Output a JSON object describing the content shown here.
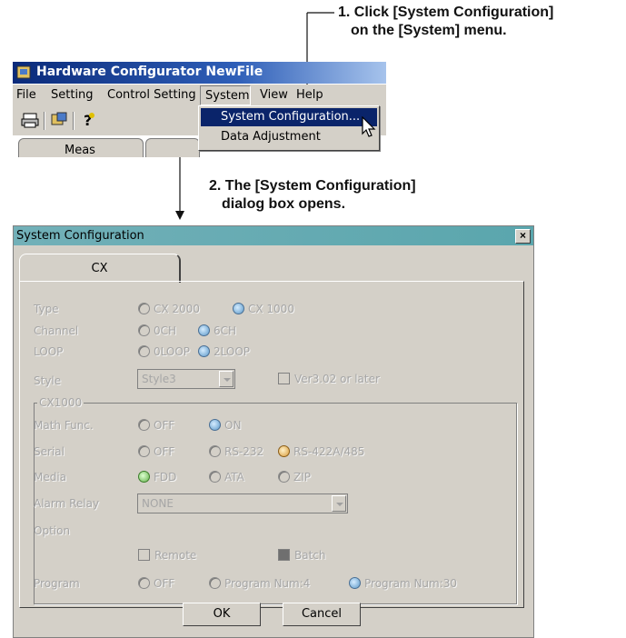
{
  "callouts": {
    "step1_line1": "1. Click [System Configuration]",
    "step1_line2": "on the [System] menu.",
    "step2_line1": "2. The [System Configuration]",
    "step2_line2": "dialog box opens."
  },
  "main_window": {
    "title": "Hardware Configurator NewFile",
    "menu": [
      "File",
      "Setting",
      "Control Setting",
      "System",
      "View",
      "Help"
    ],
    "active_menu": "System",
    "system_menu_items": [
      "System Configuration...",
      "Data Adjustment"
    ],
    "visible_tab": "Meas"
  },
  "dialog": {
    "title": "System Configuration",
    "close_label": "×",
    "tab": "CX",
    "type": {
      "label": "Type",
      "options": [
        "CX 2000",
        "CX 1000"
      ],
      "selected": "CX 1000"
    },
    "channel": {
      "label": "Channel",
      "options": [
        "0CH",
        "6CH"
      ],
      "selected": "6CH"
    },
    "loop": {
      "label": "LOOP",
      "options": [
        "0LOOP",
        "2LOOP"
      ],
      "selected": "2LOOP"
    },
    "style": {
      "label": "Style",
      "value": "Style3",
      "checkbox": "Ver3.02 or later",
      "checked": false
    },
    "group_title": "CX1000",
    "math": {
      "label": "Math Func.",
      "options": [
        "OFF",
        "ON"
      ],
      "selected": "ON"
    },
    "serial": {
      "label": "Serial",
      "options": [
        "OFF",
        "RS-232",
        "RS-422A/485"
      ],
      "selected": "RS-422A/485"
    },
    "media": {
      "label": "Media",
      "options": [
        "FDD",
        "ATA",
        "ZIP"
      ],
      "selected": "FDD"
    },
    "alarm_relay": {
      "label": "Alarm Relay",
      "value": "NONE"
    },
    "option": {
      "label": "Option",
      "remote": "Remote",
      "remote_checked": false,
      "batch": "Batch",
      "batch_checked": true
    },
    "program": {
      "label": "Program",
      "options": [
        "OFF",
        "Program Num:4",
        "Program Num:30"
      ],
      "selected": "Program Num:30"
    },
    "ok": "OK",
    "cancel": "Cancel"
  },
  "colors": {
    "dialog_bg": "#d4d0c8",
    "titlebar_dialog": "#66aab2",
    "titlebar_main": "#0a246a",
    "disabled_text": "#a6a6a6"
  }
}
